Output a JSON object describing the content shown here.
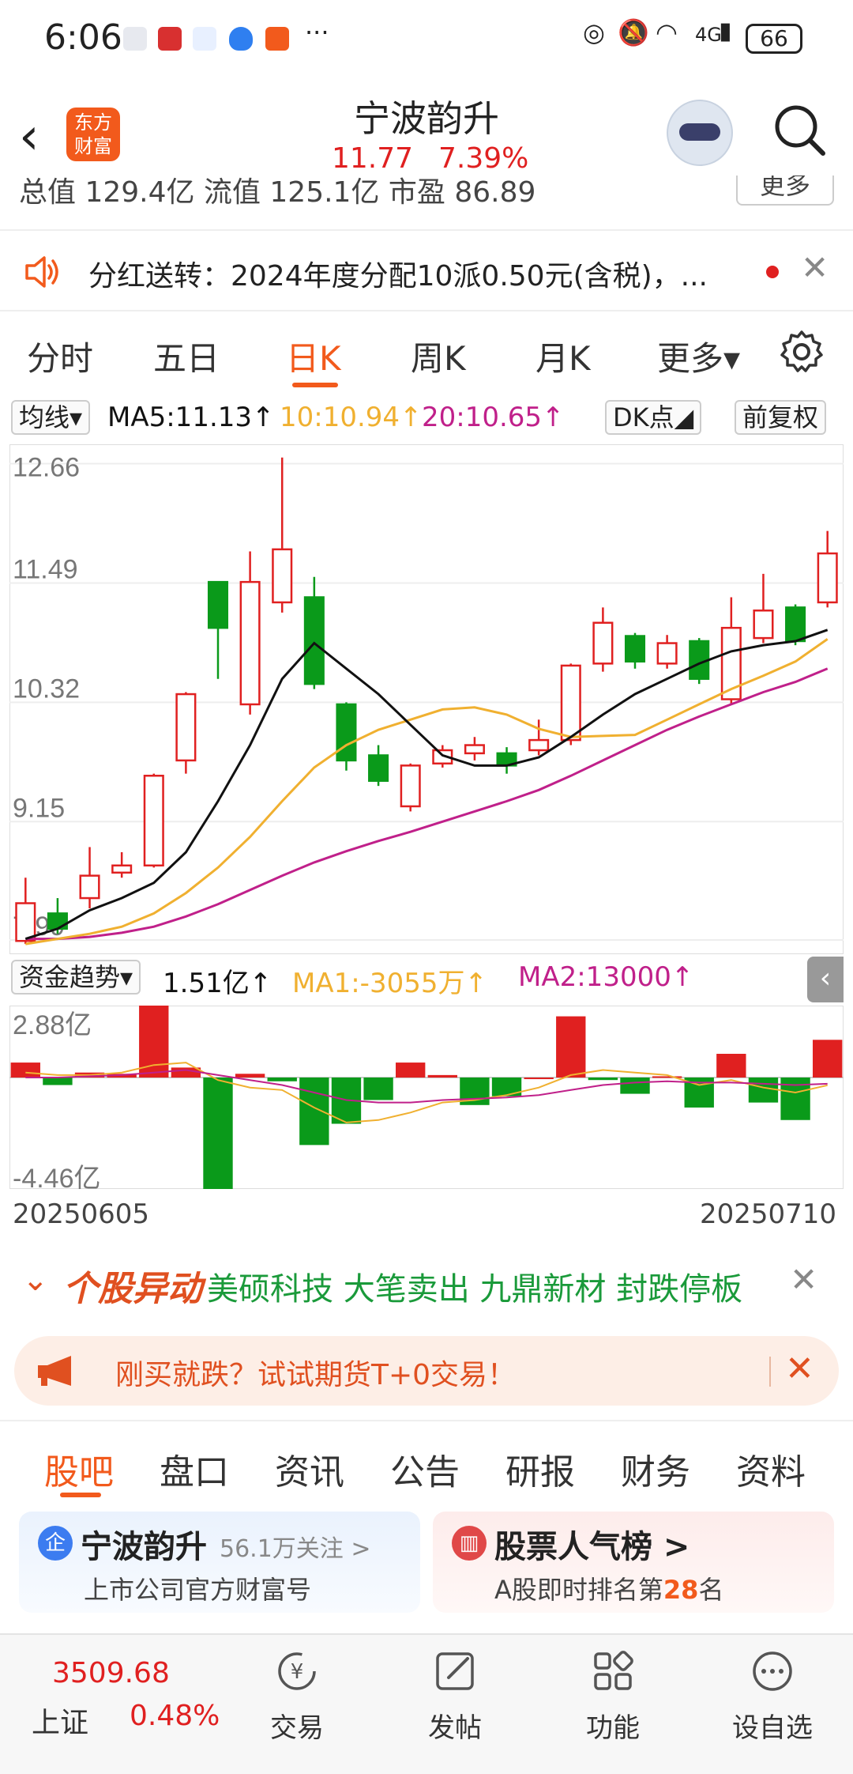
{
  "status_bar": {
    "time": "6:06",
    "signal": "4G",
    "battery": "66"
  },
  "header": {
    "back_icon": "chevron-left-icon",
    "logo_line1": "东方",
    "logo_line2": "财富",
    "title": "宁波韵升",
    "price": "11.77",
    "change_pct": "7.39%"
  },
  "info_row": {
    "text": "总值  129.4亿   流值 125.1亿   市盈    86.89",
    "more_label": "更多"
  },
  "notice": {
    "text": "分红送转：2024年度分配10派0.50元(含税)，..."
  },
  "tabs": [
    "分时",
    "五日",
    "日K",
    "周K",
    "月K",
    "更多▾"
  ],
  "active_tab": 2,
  "ma_row": {
    "select_label": "均线▾",
    "ma5": "MA5:11.13↑",
    "ma10": "10:10.94↑",
    "ma20": "20:10.65↑",
    "dk_label": "DK点◢",
    "adjust_label": "前复权"
  },
  "fund_row": {
    "select_label": "资金趋势▾",
    "value": "1.51亿↑",
    "ma1": "MA1:-3055万↑",
    "ma2": "MA2:13000↑"
  },
  "colors": {
    "up": "#e02020",
    "down": "#0a9a1a",
    "ma5": "#111111",
    "ma10": "#f0b030",
    "ma20": "#c0208a",
    "brand": "#f25a1c"
  },
  "chart_data": [
    {
      "type": "candlestick",
      "title": "日K",
      "y_ticks": [
        "12.66",
        "11.49",
        "10.32",
        "9.15",
        "7.99"
      ],
      "ylim": [
        7.85,
        12.85
      ],
      "candles": [
        {
          "o": 7.98,
          "c": 8.35,
          "h": 8.6,
          "l": 7.95
        },
        {
          "o": 8.25,
          "c": 8.1,
          "h": 8.4,
          "l": 8.05
        },
        {
          "o": 8.4,
          "c": 8.62,
          "h": 8.9,
          "l": 8.3
        },
        {
          "o": 8.65,
          "c": 8.72,
          "h": 8.85,
          "l": 8.6
        },
        {
          "o": 8.72,
          "c": 9.6,
          "h": 9.62,
          "l": 8.7
        },
        {
          "o": 9.75,
          "c": 10.4,
          "h": 10.42,
          "l": 9.62
        },
        {
          "o": 11.5,
          "c": 11.05,
          "h": 11.5,
          "l": 10.55
        },
        {
          "o": 10.3,
          "c": 11.5,
          "h": 11.8,
          "l": 10.2
        },
        {
          "o": 11.3,
          "c": 11.82,
          "h": 12.72,
          "l": 11.2
        },
        {
          "o": 11.35,
          "c": 10.5,
          "h": 11.55,
          "l": 10.45
        },
        {
          "o": 10.3,
          "c": 9.75,
          "h": 10.32,
          "l": 9.65
        },
        {
          "o": 9.8,
          "c": 9.55,
          "h": 9.9,
          "l": 9.5
        },
        {
          "o": 9.3,
          "c": 9.7,
          "h": 9.72,
          "l": 9.25
        },
        {
          "o": 9.72,
          "c": 9.85,
          "h": 9.9,
          "l": 9.68
        },
        {
          "o": 9.82,
          "c": 9.9,
          "h": 9.98,
          "l": 9.75
        },
        {
          "o": 9.82,
          "c": 9.7,
          "h": 9.88,
          "l": 9.62
        },
        {
          "o": 9.85,
          "c": 9.95,
          "h": 10.15,
          "l": 9.8
        },
        {
          "o": 9.95,
          "c": 10.68,
          "h": 10.7,
          "l": 9.9
        },
        {
          "o": 10.7,
          "c": 11.1,
          "h": 11.25,
          "l": 10.62
        },
        {
          "o": 10.97,
          "c": 10.72,
          "h": 11.0,
          "l": 10.65
        },
        {
          "o": 10.7,
          "c": 10.9,
          "h": 10.98,
          "l": 10.65
        },
        {
          "o": 10.92,
          "c": 10.55,
          "h": 10.95,
          "l": 10.5
        },
        {
          "o": 10.35,
          "c": 11.05,
          "h": 11.35,
          "l": 10.3
        },
        {
          "o": 10.95,
          "c": 11.22,
          "h": 11.58,
          "l": 10.9
        },
        {
          "o": 11.25,
          "c": 10.92,
          "h": 11.28,
          "l": 10.88
        },
        {
          "o": 11.3,
          "c": 11.78,
          "h": 12.0,
          "l": 11.25
        }
      ],
      "ma5": [
        8.0,
        8.1,
        8.28,
        8.4,
        8.55,
        8.85,
        9.35,
        9.9,
        10.55,
        10.9,
        10.65,
        10.4,
        10.1,
        9.8,
        9.7,
        9.7,
        9.78,
        9.98,
        10.2,
        10.4,
        10.55,
        10.7,
        10.82,
        10.88,
        10.92,
        11.03
      ],
      "ma10": [
        7.95,
        8.0,
        8.05,
        8.12,
        8.25,
        8.45,
        8.7,
        9.0,
        9.35,
        9.68,
        9.9,
        10.05,
        10.15,
        10.25,
        10.27,
        10.2,
        10.06,
        9.98,
        9.99,
        10.0,
        10.15,
        10.3,
        10.45,
        10.58,
        10.72,
        10.94
      ],
      "ma20": [
        8.0,
        8.0,
        8.02,
        8.06,
        8.12,
        8.22,
        8.34,
        8.48,
        8.62,
        8.75,
        8.86,
        8.96,
        9.05,
        9.15,
        9.25,
        9.35,
        9.46,
        9.6,
        9.75,
        9.9,
        10.05,
        10.18,
        10.3,
        10.42,
        10.52,
        10.65
      ]
    },
    {
      "type": "bar",
      "title": "资金趋势",
      "y_ticks": [
        "2.88亿",
        "-4.46亿"
      ],
      "ylim": [
        -4.46,
        2.88
      ],
      "values": [
        0.6,
        -0.3,
        0.2,
        0.15,
        2.88,
        0.4,
        -4.46,
        0.15,
        -0.15,
        -2.7,
        -1.85,
        -0.9,
        0.6,
        0.1,
        -1.1,
        -0.75,
        0.0,
        2.45,
        -0.1,
        -0.65,
        0.05,
        -1.2,
        0.95,
        -1.0,
        -1.7,
        1.51
      ],
      "ma1": [
        0.2,
        0.1,
        0.1,
        0.2,
        0.5,
        0.6,
        -0.1,
        -0.4,
        -0.5,
        -1.2,
        -1.8,
        -1.7,
        -1.4,
        -1.0,
        -0.9,
        -0.7,
        -0.4,
        0.1,
        0.3,
        0.2,
        0.1,
        -0.3,
        -0.1,
        -0.4,
        -0.6,
        -0.31
      ],
      "ma2": [
        0.0,
        0.0,
        0.05,
        0.1,
        0.2,
        0.3,
        0.1,
        -0.1,
        -0.3,
        -0.6,
        -0.9,
        -1.0,
        -1.0,
        -0.9,
        -0.85,
        -0.8,
        -0.7,
        -0.5,
        -0.3,
        -0.2,
        -0.15,
        -0.2,
        -0.2,
        -0.25,
        -0.3,
        -0.25
      ],
      "x_start": "20250605",
      "x_end": "20250710"
    }
  ],
  "abnormal": {
    "title": "个股异动",
    "items": "美硕科技  大笔卖出  九鼎新材  封跌停板"
  },
  "futures_banner": {
    "text": "刚买就跌？试试期货T+0交易！"
  },
  "bottom_tabs": [
    "股吧",
    "盘口",
    "资讯",
    "公告",
    "研报",
    "财务",
    "资料"
  ],
  "card1": {
    "badge": "企",
    "title": "宁波韵升",
    "follow": "56.1万关注 >",
    "sub": "上市公司官方财富号"
  },
  "card2": {
    "title": "股票人气榜 >",
    "sub_prefix": "A股即时排名第",
    "rank": "28",
    "sub_suffix": "名"
  },
  "bottom_nav": {
    "index_value": "3509.68",
    "index_name": "上证",
    "index_pct": "0.48%",
    "items": [
      "交易",
      "发帖",
      "功能",
      "设自选"
    ]
  }
}
